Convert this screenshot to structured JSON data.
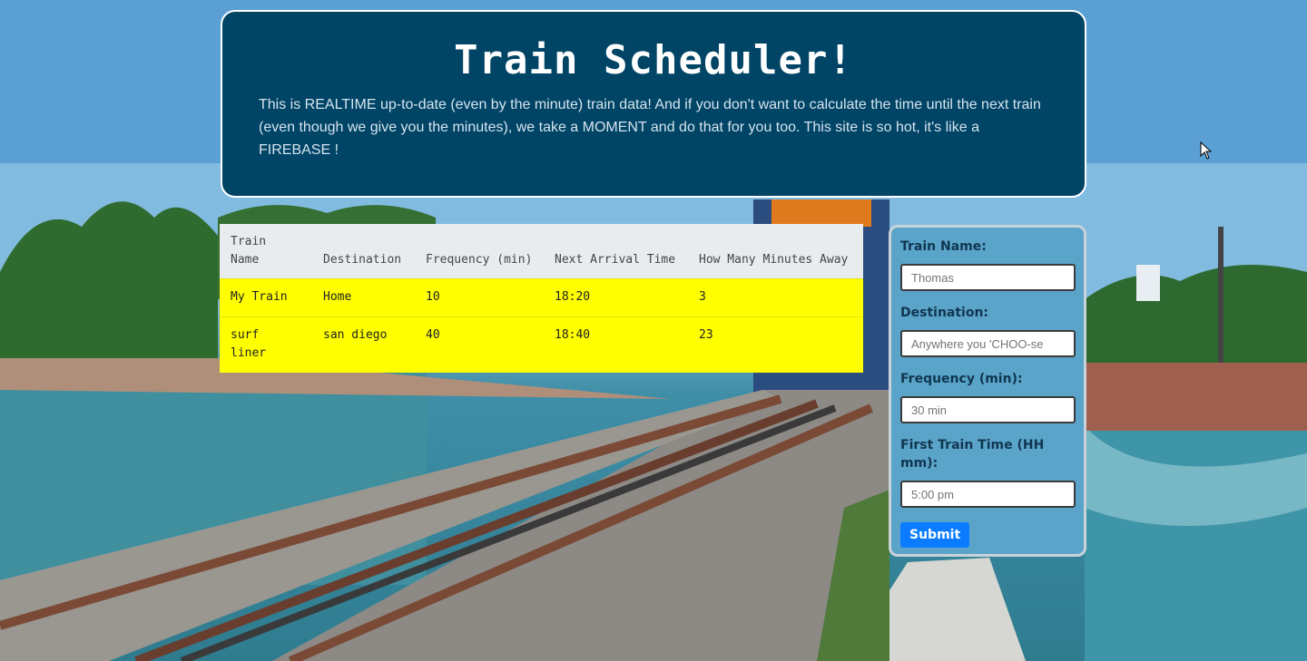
{
  "header": {
    "title": "Train Scheduler!",
    "intro": "This is REALTIME up-to-date (even by the minute) train data! And if you don't want to calculate the time until the next train (even though we give you the minutes), we take a MOMENT and do that for you too. This site is so hot, it's like a FIREBASE !"
  },
  "table": {
    "headers": [
      "Train Name",
      "Destination",
      "Frequency (min)",
      "Next Arrival Time",
      "How Many Minutes Away"
    ],
    "rows": [
      [
        "My Train",
        "Home",
        "10",
        "18:20",
        "3"
      ],
      [
        "surf liner",
        "san diego",
        "40",
        "18:40",
        "23"
      ]
    ],
    "row_color": "#ffff00"
  },
  "form": {
    "train_name_label": "Train Name:",
    "train_name_placeholder": "Thomas",
    "destination_label": "Destination:",
    "destination_placeholder": "Anywhere you 'CHOO-se",
    "frequency_label": "Frequency (min):",
    "frequency_placeholder": "30 min",
    "first_time_label": "First Train Time (HH mm):",
    "first_time_placeholder": "5:00 pm",
    "submit_label": "Submit"
  },
  "colors": {
    "header_bg": "#004466",
    "form_bg": "#5ba4c9",
    "submit_bg": "#0b7cff"
  },
  "icons": {
    "cursor": "mouse-pointer-icon"
  }
}
